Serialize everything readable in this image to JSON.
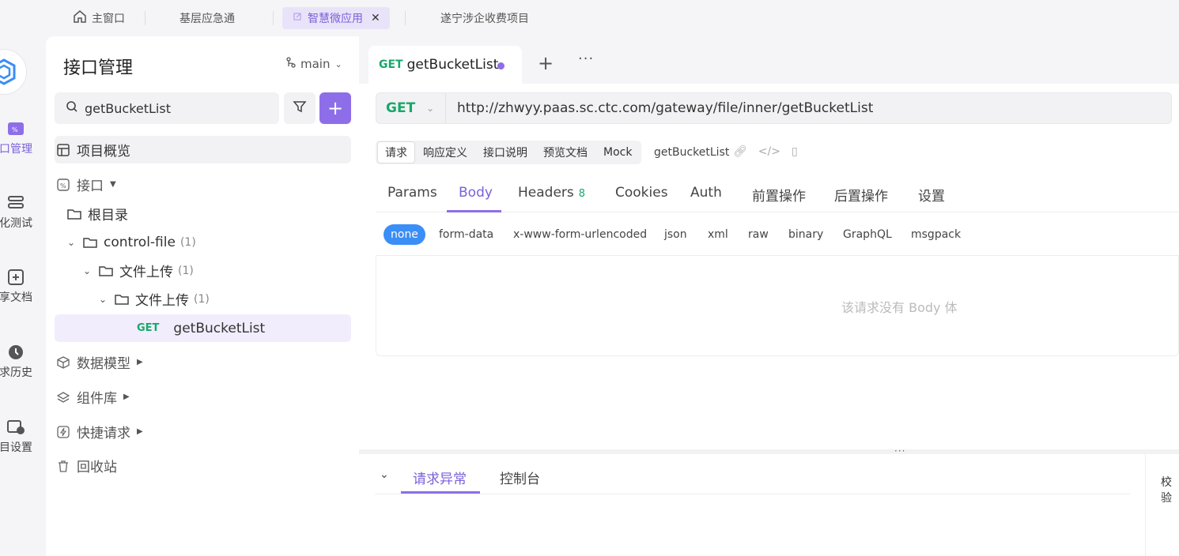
{
  "project_tabs": [
    {
      "label": "主窗口",
      "icon": "home-icon"
    },
    {
      "label": "基层应急通"
    },
    {
      "label": "智慧微应用",
      "icon": "external-icon",
      "active": true
    },
    {
      "label": "遂宁涉企收费项目"
    }
  ],
  "rail": {
    "items": [
      {
        "label": "口管理",
        "icon": "api-icon",
        "active": true
      },
      {
        "label": "化测试",
        "icon": "test-icon"
      },
      {
        "label": "享文档",
        "icon": "doc-share-icon"
      },
      {
        "label": "求历史",
        "icon": "history-icon"
      },
      {
        "label": "目设置",
        "icon": "settings-icon"
      }
    ]
  },
  "sidebar": {
    "title": "接口管理",
    "branch": "main",
    "search_value": "getBucketList",
    "tree": {
      "overview": "项目概览",
      "apis": "接口",
      "root": "根目录",
      "folder1": {
        "label": "control-file",
        "count": "(1)"
      },
      "folder2": {
        "label": "文件上传",
        "count": "(1)"
      },
      "folder3": {
        "label": "文件上传",
        "count": "(1)"
      },
      "api_item": {
        "method": "GET",
        "label": "getBucketList"
      },
      "models": "数据模型",
      "components": "组件库",
      "quick": "快捷请求",
      "trash": "回收站"
    }
  },
  "main": {
    "tab": {
      "method": "GET",
      "label": "getBucketList"
    },
    "url": {
      "method": "GET",
      "value": "http://zhwyy.paas.sc.ctc.com/gateway/file/inner/getBucketList"
    },
    "subtabs": [
      "请求",
      "响应定义",
      "接口说明",
      "预览文档",
      "Mock"
    ],
    "api_name": "getBucketList",
    "request_tabs": [
      {
        "label": "Params"
      },
      {
        "label": "Body",
        "active": true
      },
      {
        "label": "Headers",
        "badge": "8"
      },
      {
        "label": "Cookies"
      },
      {
        "label": "Auth"
      },
      {
        "label": "前置操作"
      },
      {
        "label": "后置操作"
      },
      {
        "label": "设置"
      }
    ],
    "body_types": [
      "none",
      "form-data",
      "x-www-form-urlencoded",
      "json",
      "xml",
      "raw",
      "binary",
      "GraphQL",
      "msgpack"
    ],
    "body_empty": "该请求没有 Body 体",
    "bottom_tabs": [
      "请求异常",
      "控制台"
    ],
    "bottom_right": "校验"
  },
  "colors": {
    "accent": "#8e6ee8",
    "get": "#17a86a",
    "selected_body": "#3a8ef6"
  }
}
